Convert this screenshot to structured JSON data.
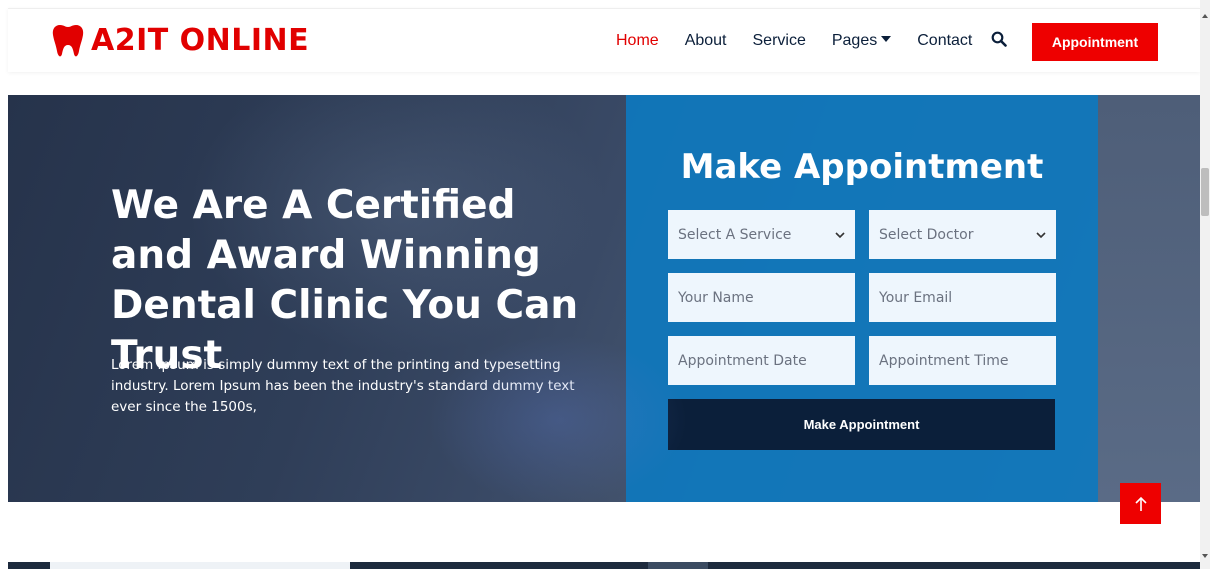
{
  "brand": {
    "name": "A2IT ONLINE",
    "color": "#e10000"
  },
  "nav": {
    "items": [
      {
        "label": "Home",
        "active": true
      },
      {
        "label": "About",
        "active": false
      },
      {
        "label": "Service",
        "active": false
      },
      {
        "label": "Pages",
        "active": false,
        "dropdown": true
      },
      {
        "label": "Contact",
        "active": false
      }
    ],
    "search_icon": "search-icon",
    "appointment_label": "Appointment"
  },
  "hero": {
    "title": "We Are A Certified and Award Winning Dental Clinic You Can Trust",
    "text": "Lorem Ipsum is simply dummy text of the printing and typesetting industry. Lorem Ipsum has been the industry's standard dummy text ever since the 1500s,"
  },
  "appointment_form": {
    "title": "Make Appointment",
    "service_select": "Select A Service",
    "doctor_select": "Select Doctor",
    "name_placeholder": "Your Name",
    "email_placeholder": "Your Email",
    "date_placeholder": "Appointment Date",
    "time_placeholder": "Appointment Time",
    "submit_label": "Make Appointment"
  },
  "colors": {
    "accent": "#ee0000",
    "panel": "#0e78be",
    "dark": "#0b1f3a"
  },
  "back_to_top_icon": "arrow-up-icon"
}
